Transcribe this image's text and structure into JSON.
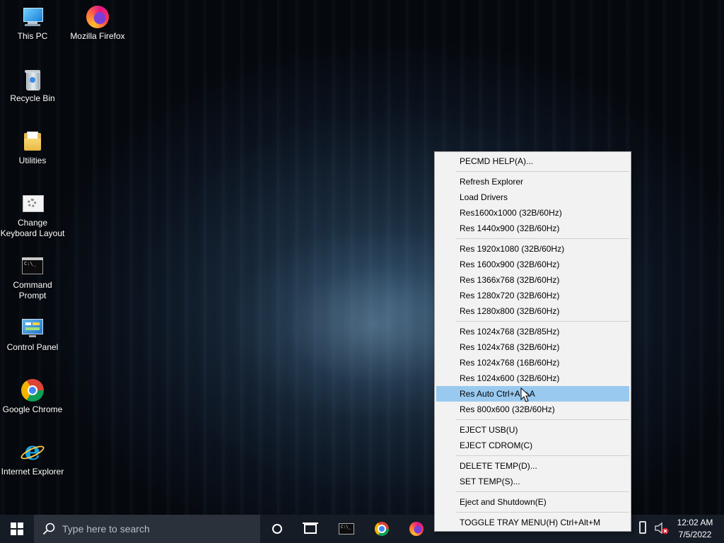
{
  "desktop": {
    "icons": [
      {
        "label": "This PC",
        "icon": "this-pc-icon"
      },
      {
        "label": "Mozilla Firefox",
        "icon": "firefox-icon"
      },
      {
        "label": "Recycle Bin",
        "icon": "recycle-bin-icon"
      },
      {
        "label": "Utilities",
        "icon": "folder-icon"
      },
      {
        "label": "Change Keyboard Layout",
        "icon": "keyboard-settings-icon"
      },
      {
        "label": "Command Prompt",
        "icon": "command-prompt-icon"
      },
      {
        "label": "Control Panel",
        "icon": "control-panel-icon"
      },
      {
        "label": "Google Chrome",
        "icon": "chrome-icon"
      },
      {
        "label": "Internet Explorer",
        "icon": "internet-explorer-icon"
      }
    ]
  },
  "context_menu": {
    "items": [
      "PECMD HELP(A)...",
      "Refresh Explorer",
      "Load Drivers",
      "Res1600x1000 (32B/60Hz)",
      "Res 1440x900 (32B/60Hz)",
      "Res 1920x1080 (32B/60Hz)",
      "Res 1600x900 (32B/60Hz)",
      "Res 1366x768 (32B/60Hz)",
      "Res 1280x720 (32B/60Hz)",
      "Res 1280x800 (32B/60Hz)",
      "Res 1024x768 (32B/85Hz)",
      "Res 1024x768 (32B/60Hz)",
      "Res 1024x768 (16B/60Hz)",
      "Res 1024x600 (32B/60Hz)",
      "Res Auto Ctrl+Alt+A",
      "Res 800x600 (32B/60Hz)",
      "EJECT USB(U)",
      "EJECT CDROM(C)",
      "DELETE TEMP(D)...",
      "SET TEMP(S)...",
      "Eject and Shutdown(E)",
      "TOGGLE TRAY MENU(H) Ctrl+Alt+M"
    ],
    "highlighted": "Res Auto Ctrl+Alt+A",
    "highlight_color": "#99c9ef"
  },
  "taskbar": {
    "search_placeholder": "Type here to search",
    "pinned": [
      "cortana-icon",
      "task-view-icon",
      "command-prompt-icon",
      "chrome-icon",
      "firefox-icon"
    ],
    "tray_icons": [
      "usb-icon",
      "volume-muted-icon"
    ],
    "clock": {
      "time": "12:02 AM",
      "date": "7/5/2022"
    }
  }
}
